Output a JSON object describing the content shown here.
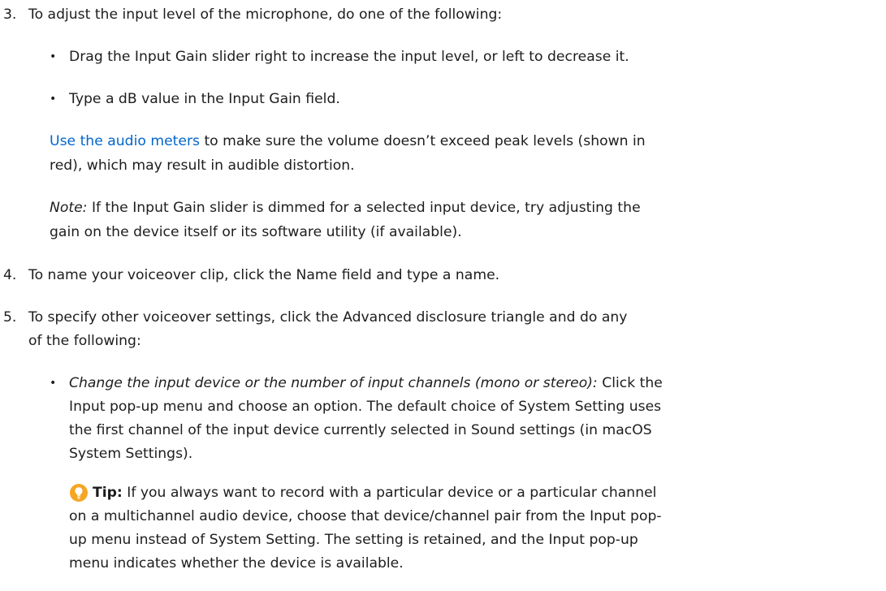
{
  "step3": {
    "number": "3.",
    "text": "To adjust the input level of the microphone, do one of the following:",
    "bullets": [
      "Drag the Input Gain slider right to increase the input level, or left to decrease it.",
      "Type a dB value in the Input Gain field."
    ],
    "link_text": "Use the audio meters",
    "para_line1_rest": " to make sure the volume doesn’t exceed peak levels (shown in",
    "para_line2": "red), which may result in audible distortion.",
    "note_label": "Note:",
    "note_line1_rest": " If the Input Gain slider is dimmed for a selected input device, try adjusting the",
    "note_line2": "gain on the device itself or its software utility (if available)."
  },
  "step4": {
    "number": "4.",
    "text": "To name your voiceover clip, click the Name field and type a name."
  },
  "step5": {
    "number": "5.",
    "line1": "To specify other voiceover settings, click the Advanced disclosure triangle and do any",
    "line2": "of the following:",
    "bullet": {
      "label": "Change the input device or the number of input channels (mono or stereo):",
      "line1_rest": " Click the",
      "line2": "Input pop-up menu and choose an option. The default choice of System Setting uses",
      "line3": "the first channel of the input device currently selected in Sound settings (in macOS",
      "line4": "System Settings)."
    },
    "tip": {
      "icon": "lightbulb-icon",
      "icon_color": "#f5a623",
      "label": "Tip:",
      "line1_rest": " If you always want to record with a particular device or a particular channel",
      "line2": "on a multichannel audio device, choose that device/channel pair from the Input pop-",
      "line3": "up menu instead of System Setting. The setting is retained, and the Input pop-up",
      "line4": "menu indicates whether the device is available."
    }
  }
}
